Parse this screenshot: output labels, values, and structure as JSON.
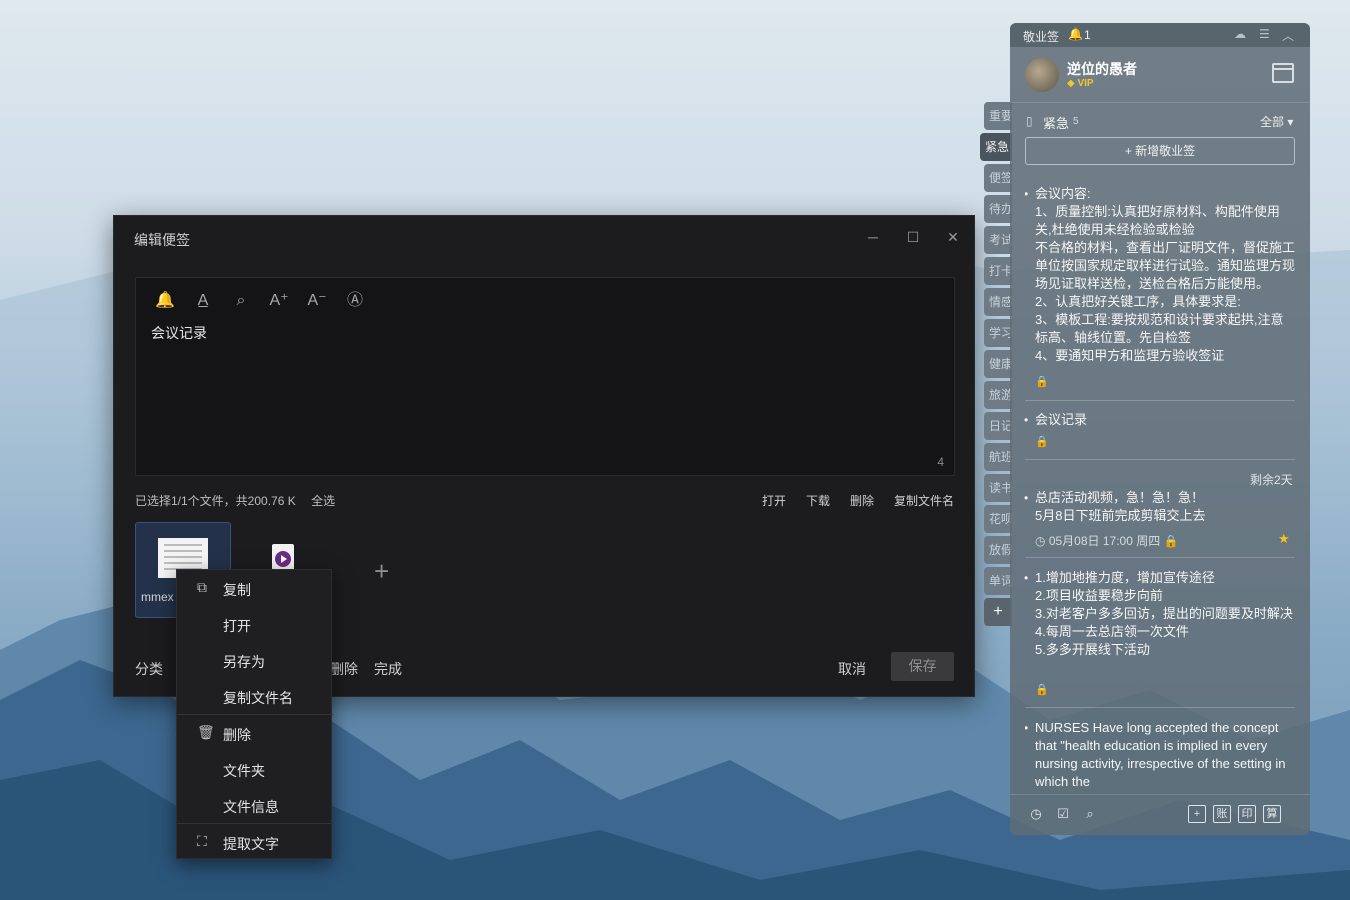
{
  "editor": {
    "title": "编辑便签",
    "window_buttons": {
      "minimize": "─",
      "maximize": "☐",
      "close": "✕"
    },
    "toolbar": [
      {
        "name": "reminder-bell-icon",
        "glyph": "🔔"
      },
      {
        "name": "text-color-icon",
        "glyph": "A̲"
      },
      {
        "name": "search-icon",
        "glyph": "⌕"
      },
      {
        "name": "font-increase-icon",
        "glyph": "A⁺"
      },
      {
        "name": "font-decrease-icon",
        "glyph": "A⁻"
      },
      {
        "name": "text-format-icon",
        "glyph": "Ⓐ"
      }
    ],
    "content": "会议记录",
    "char_count": "4",
    "file_status": "已选择1/1个文件，共200.76 K",
    "select_all": "全选",
    "file_actions": {
      "open": "打开",
      "download": "下载",
      "delete": "删除",
      "copy_name": "复制文件名"
    },
    "file1_name": "mmex",
    "add_file": "+",
    "bottom": {
      "category": "分类",
      "delete": "删除",
      "done": "完成",
      "cancel": "取消",
      "save": "保存"
    }
  },
  "context_menu": {
    "items": [
      {
        "label": "复制",
        "icon": "copy-icon",
        "glyph": "⧉"
      },
      {
        "label": "打开",
        "icon": "",
        "glyph": ""
      },
      {
        "label": "另存为",
        "icon": "",
        "glyph": ""
      },
      {
        "label": "复制文件名",
        "icon": "",
        "glyph": ""
      },
      {
        "label": "删除",
        "icon": "trash-icon",
        "glyph": "🗑"
      },
      {
        "label": "文件夹",
        "icon": "",
        "glyph": ""
      },
      {
        "label": "文件信息",
        "icon": "",
        "glyph": ""
      },
      {
        "label": "提取文字",
        "icon": "ocr-icon",
        "glyph": "⛶"
      }
    ]
  },
  "side_tabs": [
    "重要",
    "紧急",
    "便签",
    "待办",
    "考试",
    "打卡",
    "情感",
    "学习",
    "健康",
    "旅游",
    "日记",
    "航班",
    "读书",
    "花呗",
    "放假",
    "单词"
  ],
  "side_tabs_active": "紧急",
  "side_add": "+",
  "panel": {
    "app_name": "敬业签",
    "bell_count": "1",
    "username": "逆位的愚者",
    "vip": "VIP",
    "category": "紧急",
    "category_count": "5",
    "filter": "全部 ▾",
    "new_note": "+ 新增敬业签",
    "notes": [
      {
        "lines": [
          "会议内容:",
          "1、质量控制:认真把好原材料、构配件使用关,杜绝使用未经检验或检验",
          "不合格的材料，查看出厂证明文件，督促施工单位按国家规定取样进行试验。通知监理方现场见证取样送检，送检合格后方能使用。",
          "2、认真把好关键工序，具体要求是:",
          "3、模板工程:要按规范和设计要求起拱,注意标高、轴线位置。先自检签",
          "4、要通知甲方和监理方验收签证"
        ]
      },
      {
        "lines": [
          "会议记录"
        ]
      },
      {
        "remaining": "剩余2天",
        "lines": [
          "总店活动视频，急！急！急！",
          "5月8日下班前完成剪辑交上去"
        ],
        "meta": "05月08日 17:00 周四"
      },
      {
        "lines": [
          "1.增加地推力度，增加宣传途径",
          "2.项目收益要稳步向前",
          "3.对老客户多多回访，提出的问题要及时解决",
          "4.每周一去总店领一次文件",
          "5.多多开展线下活动"
        ]
      },
      {
        "lines": [
          "NURSES Have long accepted the concept that \"health education is implied in every nursing activity, irrespective of the setting in which the"
        ]
      }
    ],
    "bottom_icons": [
      "clock-icon",
      "calendar-check-icon",
      "search-icon",
      "add-box-icon",
      "ledger-icon",
      "print-icon",
      "calculator-icon"
    ],
    "bottom_labels": {
      "add": "+",
      "ledger": "账",
      "print": "印",
      "calc": "算"
    }
  }
}
